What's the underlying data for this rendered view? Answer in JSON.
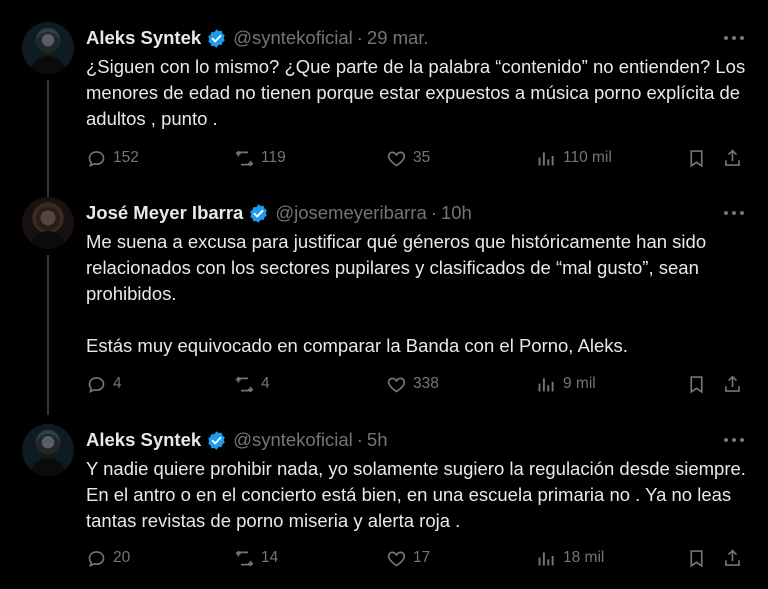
{
  "tweets": [
    {
      "name": "Aleks Syntek",
      "handle": "@syntekoficial",
      "time": "29 mar.",
      "text": "¿Siguen con lo mismo? ¿Que parte de la palabra “contenido” no entienden? Los menores de edad no tienen porque estar expuestos a música porno explícita de adultos , punto .",
      "replies": "152",
      "reposts": "119",
      "likes": "35",
      "views": "110 mil"
    },
    {
      "name": "José Meyer Ibarra",
      "handle": "@josemeyeribarra",
      "time": "10h",
      "text": "Me suena a excusa para justificar qué géneros que históricamente han sido relacionados con los sectores pupilares y clasificados de “mal gusto”, sean prohibidos.\n\nEstás muy equivocado en comparar la Banda con el Porno, Aleks.",
      "replies": "4",
      "reposts": "4",
      "likes": "338",
      "views": "9 mil"
    },
    {
      "name": "Aleks Syntek",
      "handle": "@syntekoficial",
      "time": "5h",
      "text": "Y nadie quiere prohibir nada, yo solamente sugiero la regulación desde siempre. En el antro o en el concierto está bien, en una escuela primaria no . Ya no leas tantas revistas de porno miseria y alerta roja .",
      "replies": "20",
      "reposts": "14",
      "likes": "17",
      "views": "18 mil"
    }
  ],
  "colors": {
    "background": "#000000",
    "text": "#e7e9ea",
    "muted": "#71767b",
    "verified": "#1d9bf0",
    "thread_line": "#333639"
  },
  "separator": "·",
  "icons": [
    "more-icon",
    "verified-icon",
    "reply-icon",
    "repost-icon",
    "like-icon",
    "views-icon",
    "bookmark-icon",
    "share-icon"
  ]
}
